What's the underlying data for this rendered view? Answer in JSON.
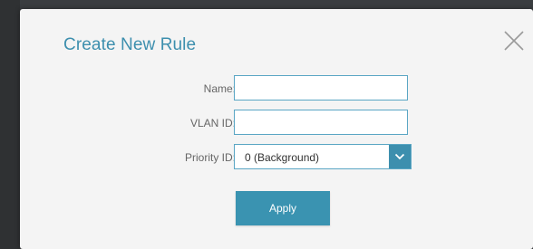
{
  "dialog": {
    "title": "Create New Rule",
    "close_icon": "close-icon"
  },
  "form": {
    "name": {
      "label": "Name:",
      "value": ""
    },
    "vlan_id": {
      "label": "VLAN ID:",
      "value": ""
    },
    "priority_id": {
      "label": "Priority ID:",
      "selected": "0 (Background)",
      "icon": "chevron-down-icon"
    }
  },
  "actions": {
    "apply_label": "Apply"
  },
  "colors": {
    "accent": "#3d8fae",
    "field_border": "#5aa6c4",
    "dialog_bg": "#f4f4f4"
  }
}
